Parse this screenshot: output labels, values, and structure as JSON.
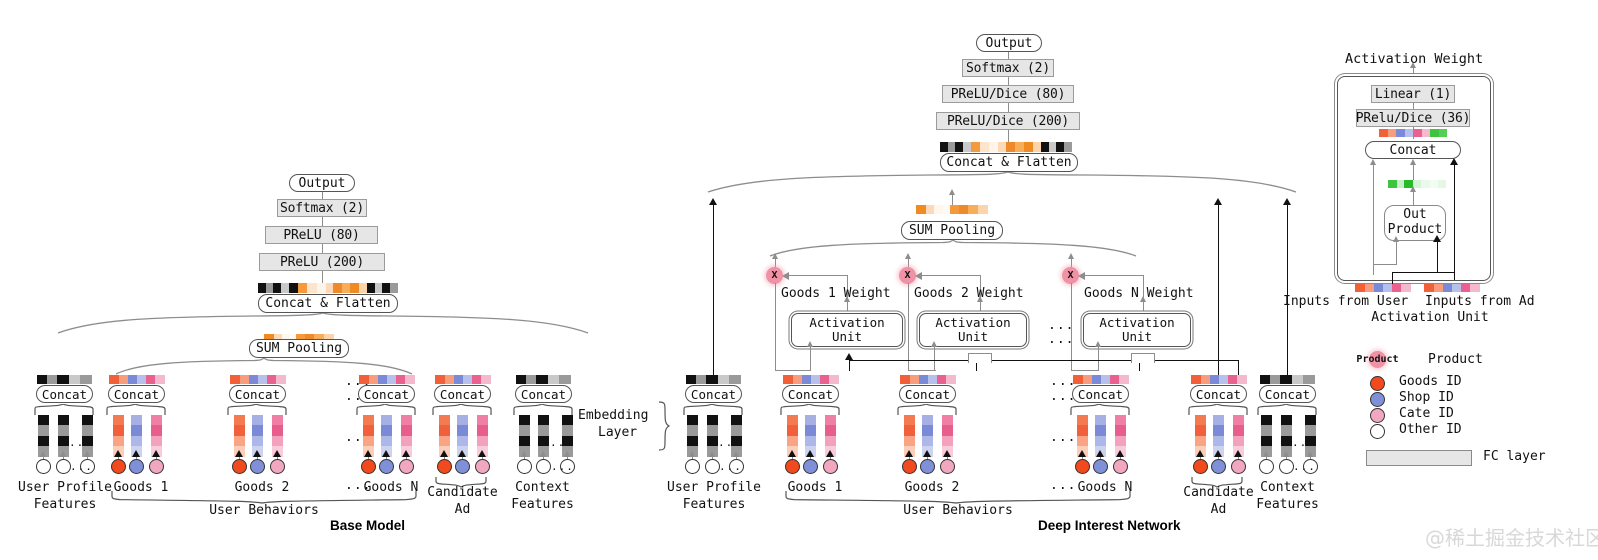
{
  "figure": {
    "watermark": "@稀土掘金技术社区"
  },
  "base_model": {
    "title": "Base Model",
    "stack": {
      "output": "Output",
      "softmax": "Softmax (2)",
      "prelu80": "PReLU (80)",
      "prelu200": "PReLU (200)",
      "concat_flatten": "Concat & Flatten",
      "sum_pooling": "SUM Pooling"
    },
    "concat_label": "Concat",
    "embedding_layer_label": "Embedding\nLayer",
    "embedding_layer_line1": "Embedding",
    "embedding_layer_line2": "Layer",
    "groups": [
      {
        "name": "user-profile-features",
        "label_line1": "User Profile",
        "label_line2": "Features",
        "kind": "other"
      },
      {
        "name": "goods-1",
        "label_line1": "Goods 1",
        "label_line2": "",
        "kind": "goods"
      },
      {
        "name": "goods-2",
        "label_line1": "Goods 2",
        "label_line2": "",
        "kind": "goods"
      },
      {
        "name": "goods-n",
        "label_line1": "Goods N",
        "label_line2": "",
        "kind": "goods"
      },
      {
        "name": "candidate-ad",
        "label_line1": "Candidate",
        "label_line2": "Ad",
        "kind": "goods"
      },
      {
        "name": "context-features",
        "label_line1": "Context",
        "label_line2": "Features",
        "kind": "other"
      }
    ],
    "user_behaviors_label": "User Behaviors",
    "ellipsis": "..."
  },
  "din": {
    "title": "Deep Interest Network",
    "stack": {
      "output": "Output",
      "softmax": "Softmax (2)",
      "prelu_dice80": "PReLU/Dice (80)",
      "prelu_dice200": "PReLU/Dice (200)",
      "concat_flatten": "Concat & Flatten",
      "sum_pooling": "SUM Pooling"
    },
    "concat_label": "Concat",
    "activation_unit_line1": "Activation",
    "activation_unit_line2": "Unit",
    "weights": [
      "Goods 1 Weight",
      "Goods 2 Weight",
      "Goods N Weight"
    ],
    "product_symbol": "X",
    "groups": [
      {
        "name": "user-profile-features",
        "label_line1": "User Profile",
        "label_line2": "Features",
        "kind": "other"
      },
      {
        "name": "goods-1",
        "label_line1": "Goods 1",
        "label_line2": "",
        "kind": "goods"
      },
      {
        "name": "goods-2",
        "label_line1": "Goods 2",
        "label_line2": "",
        "kind": "goods"
      },
      {
        "name": "goods-n",
        "label_line1": "Goods N",
        "label_line2": "",
        "kind": "goods"
      },
      {
        "name": "candidate-ad",
        "label_line1": "Candidate",
        "label_line2": "Ad",
        "kind": "goods"
      },
      {
        "name": "context-features",
        "label_line1": "Context",
        "label_line2": "Features",
        "kind": "other"
      }
    ],
    "user_behaviors_label": "User Behaviors",
    "ellipsis": "..."
  },
  "activation_unit_panel": {
    "title": "Activation Weight",
    "linear": "Linear (1)",
    "prelu_dice36": "PRelu/Dice (36)",
    "concat": "Concat",
    "out_product_line1": "Out",
    "out_product_line2": "Product",
    "inputs_user": "Inputs from User",
    "inputs_ad": "Inputs from Ad",
    "caption": "Activation Unit"
  },
  "legend": {
    "product": "Product",
    "items": [
      {
        "label": "Goods ID",
        "color": "#f04a1e"
      },
      {
        "label": "Shop ID",
        "color": "#8090d8"
      },
      {
        "label": "Cate ID",
        "color": "#f2a7c0"
      },
      {
        "label": "Other ID",
        "color": "#ffffff"
      }
    ],
    "product_color": "#ef92a5",
    "fc_layer": "FC layer",
    "fc_color": "#e6e6e6"
  },
  "palette": {
    "goods_orange": "#f04a1e",
    "shop_blue": "#8090d8",
    "cate_pink": "#f2a7c0",
    "other_black": "#111111",
    "other_gray": "#9a9a9a",
    "green": "#3fc43f",
    "line_gray": "#8d8d8d",
    "fc_fill": "#e6e6e6"
  }
}
